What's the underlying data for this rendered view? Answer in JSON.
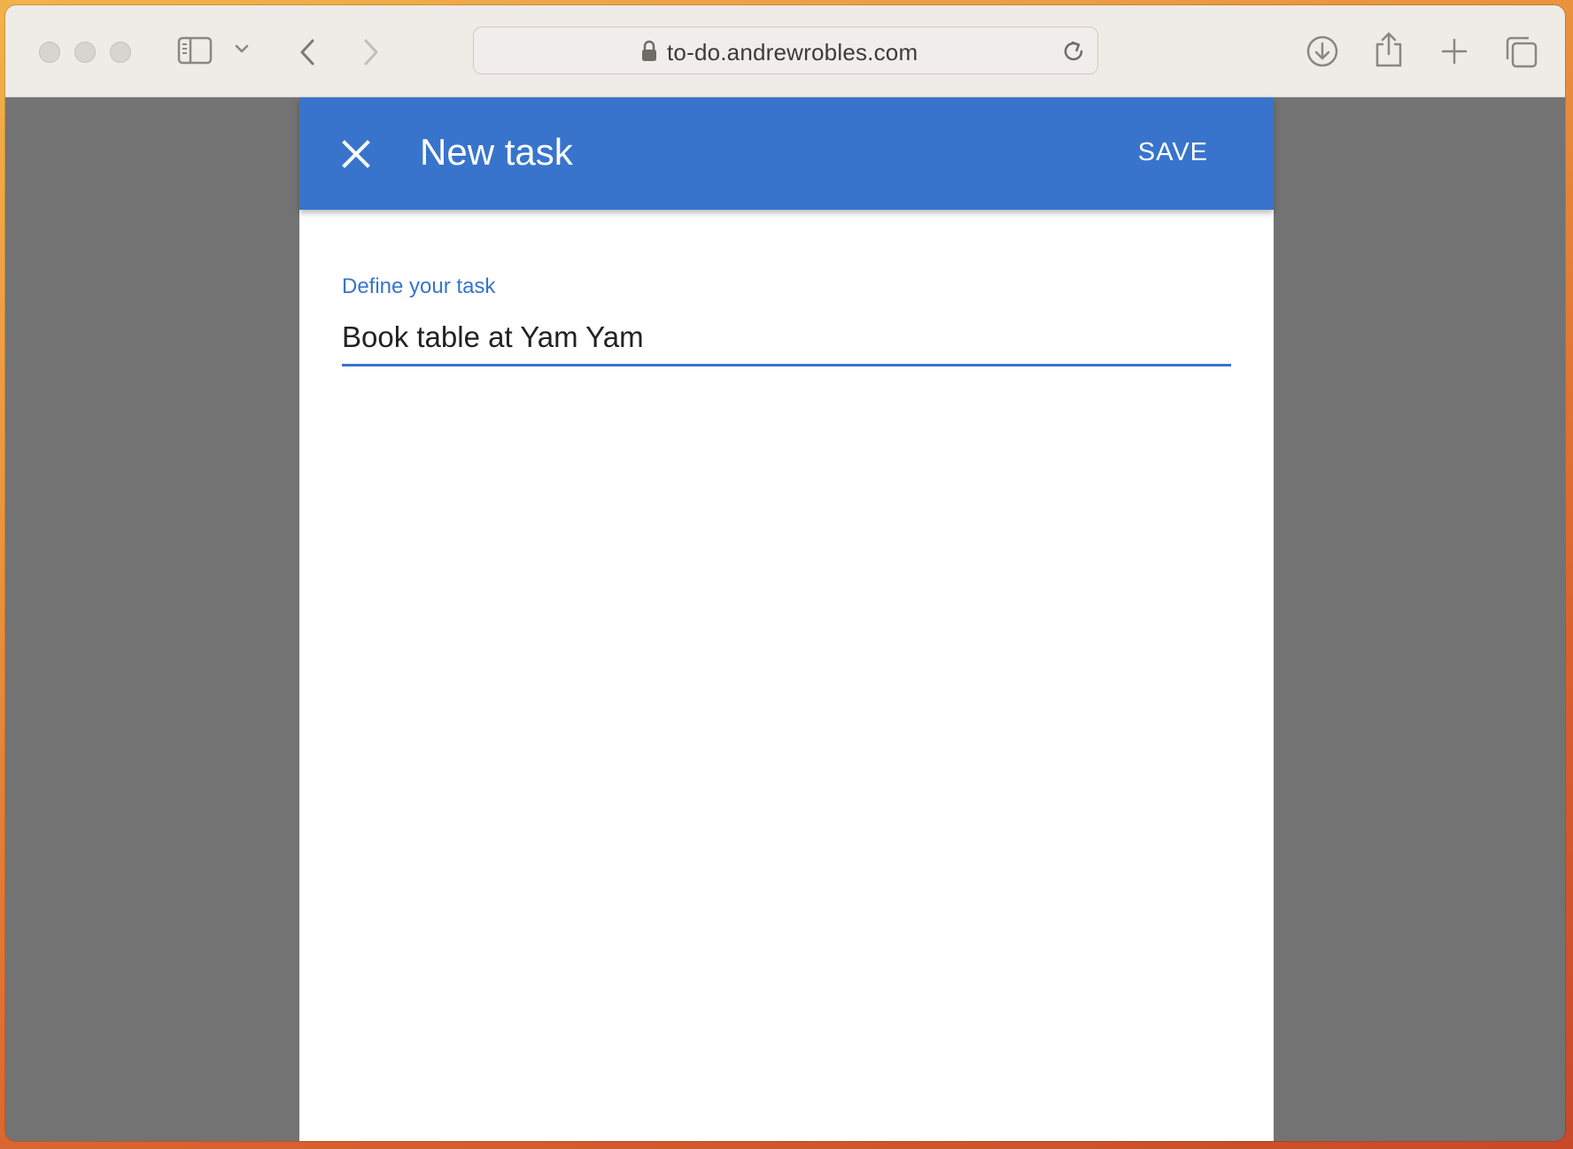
{
  "browser": {
    "url": "to-do.andrewrobles.com",
    "icons": {
      "sidebar": "sidebar-icon",
      "chevron": "chevron-down-icon",
      "back": "back-icon",
      "forward": "forward-icon",
      "lock": "lock-icon",
      "reload": "reload-icon",
      "download": "download-icon",
      "share": "share-icon",
      "new_tab": "plus-icon",
      "tabs": "tab-overview-icon"
    }
  },
  "dialog": {
    "title": "New task",
    "save_label": "SAVE",
    "close_icon": "close-icon",
    "field": {
      "label": "Define your task",
      "value": "Book table at Yam Yam"
    }
  },
  "colors": {
    "accent": "#3874cc",
    "backdrop": "#737373",
    "toolbar": "#efebe7"
  }
}
